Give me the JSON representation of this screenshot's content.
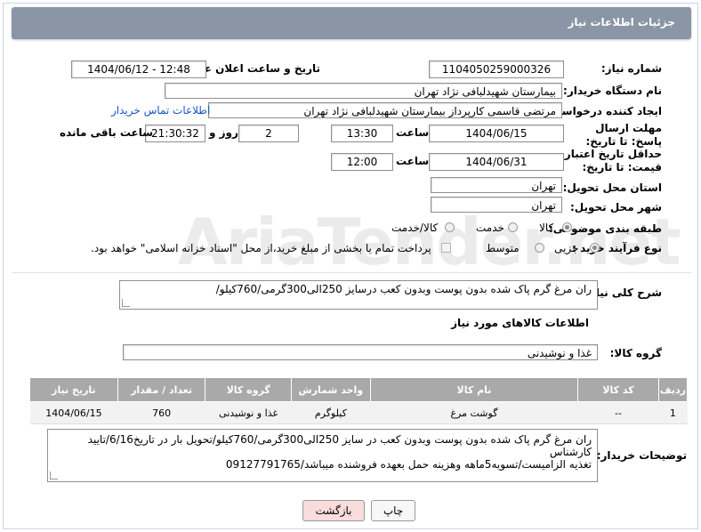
{
  "header": {
    "title": "جزئیات اطلاعات نیاز"
  },
  "form": {
    "need_number_label": "شماره نیاز:",
    "need_number": "1104050259000326",
    "announce_label": "تاریخ و ساعت اعلان عمومی:",
    "announce_value": "1404/06/12 - 12:48",
    "buyer_org_label": "نام دستگاه خریدار:",
    "buyer_org": "بیمارستان شهیدلبافی نژاد تهران",
    "requester_label": "ایجاد کننده درخواست:",
    "requester": "مرتضی  قاسمی کارپرداز بیمارستان شهیدلبافی نژاد تهران",
    "contact_link": "اطلاعات تماس خریدار",
    "deadline_label": "مهلت ارسال پاسخ: تا تاریخ:",
    "deadline_date": "1404/06/15",
    "time_label": "ساعت",
    "deadline_time": "13:30",
    "days_value": "2",
    "days_label": "روز و",
    "remaining_time": "21:30:32",
    "remaining_label": "ساعت باقی مانده",
    "validity_label": "حداقل تاریخ اعتبار قیمت: تا تاریخ:",
    "validity_date": "1404/06/31",
    "validity_time_label": "ساعت",
    "validity_time": "12:00",
    "province_label": "استان محل تحویل:",
    "province": "تهران",
    "city_label": "شهر محل تحویل:",
    "city": "تهران",
    "category_label": "طبقه بندی موضوعی:",
    "category_options": [
      "کالا",
      "خدمت",
      "کالا/خدمت"
    ],
    "process_label": "نوع فرآیند خرید :",
    "process_options": [
      "جزیی",
      "متوسط"
    ],
    "payment_note": "پرداخت تمام یا بخشی از مبلغ خرید،از محل \"اسناد خزانه اسلامی\" خواهد بود."
  },
  "description": {
    "label": "شرح کلی نیاز:",
    "text": "ران مرغ گرم پاک شده بدون پوست وبدون کعب درسایز 250الی300گرمی/760کیلو/"
  },
  "goods": {
    "section_title": "اطلاعات کالاهای مورد نیاز",
    "group_label": "گروه کالا:",
    "group_value": "غذا و نوشیدنی",
    "columns": [
      "ردیف",
      "کد کالا",
      "نام کالا",
      "واحد شمارش",
      "گروه کالا",
      "تعداد / مقدار",
      "تاریخ نیاز"
    ],
    "rows": [
      [
        "1",
        "--",
        "گوشت مرغ",
        "کیلوگرم",
        "غذا و نوشیدنی",
        "760",
        "1404/06/15"
      ]
    ]
  },
  "buyer_notes": {
    "label": "توضیحات خریدار:",
    "line1": "ران مرغ گرم پاک شده بدون پوست وبدون کعب در سایز 250الی300گرمی/760کیلو/تحویل بار در تاریخ6/16/تایید کارشناس",
    "line2": "تغذیه الزامیست/تسویه5ماهه وهزینه حمل بعهده فروشنده میباشد/09127791765"
  },
  "buttons": {
    "print": "چاپ",
    "back": "بازگشت"
  },
  "watermark": "AriaTender.net",
  "colors": {
    "titlebar": "#8a95a6",
    "table_header": "#a9a9a9",
    "link": "#1a55c9",
    "back_button": "#f9dcdc"
  }
}
